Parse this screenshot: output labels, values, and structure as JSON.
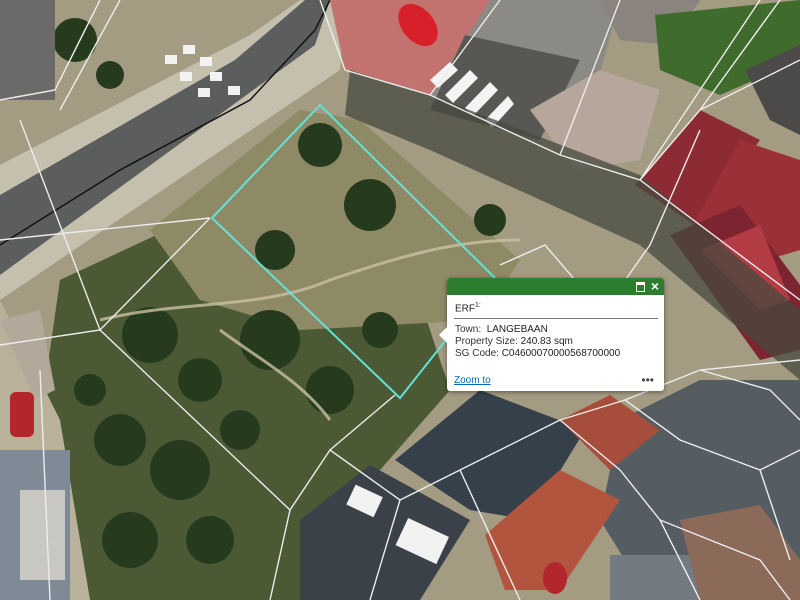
{
  "colors": {
    "popup_header": "#2c7d2e",
    "selection_outline": "#64e0d8",
    "parcel_lines": "#e9e9e9",
    "link": "#0069c2"
  },
  "popup": {
    "title": "ERF",
    "title_suffix": "1:",
    "town_label": "Town:",
    "town_value": "LANGEBAAN",
    "size_label": "Property Size:",
    "size_value": "240.83 sqm",
    "sg_label": "SG Code:",
    "sg_value": "C04600070000568700000",
    "zoom_link": "Zoom to",
    "more_icon": "more-horizontal-icon",
    "maximize_icon": "maximize-icon",
    "close_icon": "close-icon"
  }
}
